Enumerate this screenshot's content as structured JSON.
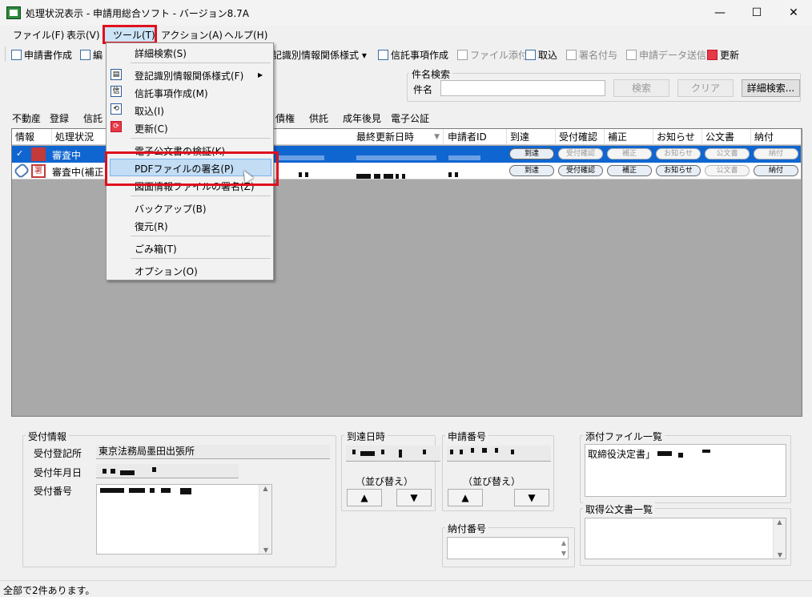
{
  "window": {
    "title": "処理状況表示 - 申請用総合ソフト - バージョン8.7A",
    "minimize": "—",
    "maximize": "☐",
    "close": "✕"
  },
  "menubar": {
    "file": "ファイル(F)",
    "view": "表示(V)",
    "tools": "ツール(T)",
    "action": "アクション(A)",
    "help": "ヘルプ(H)"
  },
  "toolbar": {
    "create_app": "申請書作成",
    "edit": "編",
    "id_info": "記識別情報関係様式 ▾",
    "trust": "信託事項作成",
    "attach": "ファイル添付",
    "import": "取込",
    "sign": "署名付与",
    "send": "申請データ送信",
    "refresh": "更新"
  },
  "search": {
    "group_title": "件名検索",
    "subject_label": "件名",
    "subject_value": "",
    "search_button": "検索",
    "clear_button": "クリア",
    "detail_button": "詳細検索..."
  },
  "category_tabs": [
    "不動産",
    "登録",
    "信託",
    "債権",
    "供託",
    "成年後見",
    "電子公証"
  ],
  "grid": {
    "columns": [
      "情報",
      "処理状況",
      "最終更新日時",
      "申請者ID",
      "到達",
      "受付確認",
      "補正",
      "お知らせ",
      "公文書",
      "納付"
    ],
    "rows": [
      {
        "status": "審査中",
        "btn_arrival": "到達",
        "btn_receipt": "受付確認",
        "btn_correction": "補正",
        "btn_notice": "お知らせ",
        "btn_doc": "公文書",
        "btn_payment": "納付"
      },
      {
        "status": "審査中(補正",
        "btn_arrival": "到達",
        "btn_receipt": "受付確認",
        "btn_correction": "補正",
        "btn_notice": "お知らせ",
        "btn_doc": "公文書",
        "btn_payment": "納付"
      }
    ]
  },
  "tools_menu": {
    "detail_search": "詳細検索(S)",
    "id_info_forms": "登記識別情報関係様式(F)",
    "trust_create": "信託事項作成(M)",
    "import": "取込(I)",
    "refresh": "更新(C)",
    "verify_doc": "電子公文書の検証(K)",
    "pdf_sign": "PDFファイルの署名(P)",
    "drawing_sign": "図面情報ファイルの署名(Z)",
    "backup": "バックアップ(B)",
    "restore": "復元(R)",
    "trash": "ごみ箱(T)",
    "options": "オプション(O)",
    "submenu_arrow": "▶"
  },
  "receipt_info": {
    "group_title": "受付情報",
    "office_label": "受付登記所",
    "office_value": "東京法務局墨田出張所",
    "date_label": "受付年月日",
    "number_label": "受付番号"
  },
  "arrival": {
    "group_title": "到達日時",
    "sort_label": "（並び替え）",
    "up": "▲",
    "down": "▼"
  },
  "app_number": {
    "group_title": "申請番号",
    "sort_label": "（並び替え）",
    "up": "▲",
    "down": "▼"
  },
  "payment_number": {
    "group_title": "納付番号"
  },
  "attachments": {
    "group_title": "添付ファイル一覧",
    "item": "取締役決定書」"
  },
  "official_docs": {
    "group_title": "取得公文書一覧"
  },
  "status_bar": {
    "text": "全部で2件あります。"
  }
}
